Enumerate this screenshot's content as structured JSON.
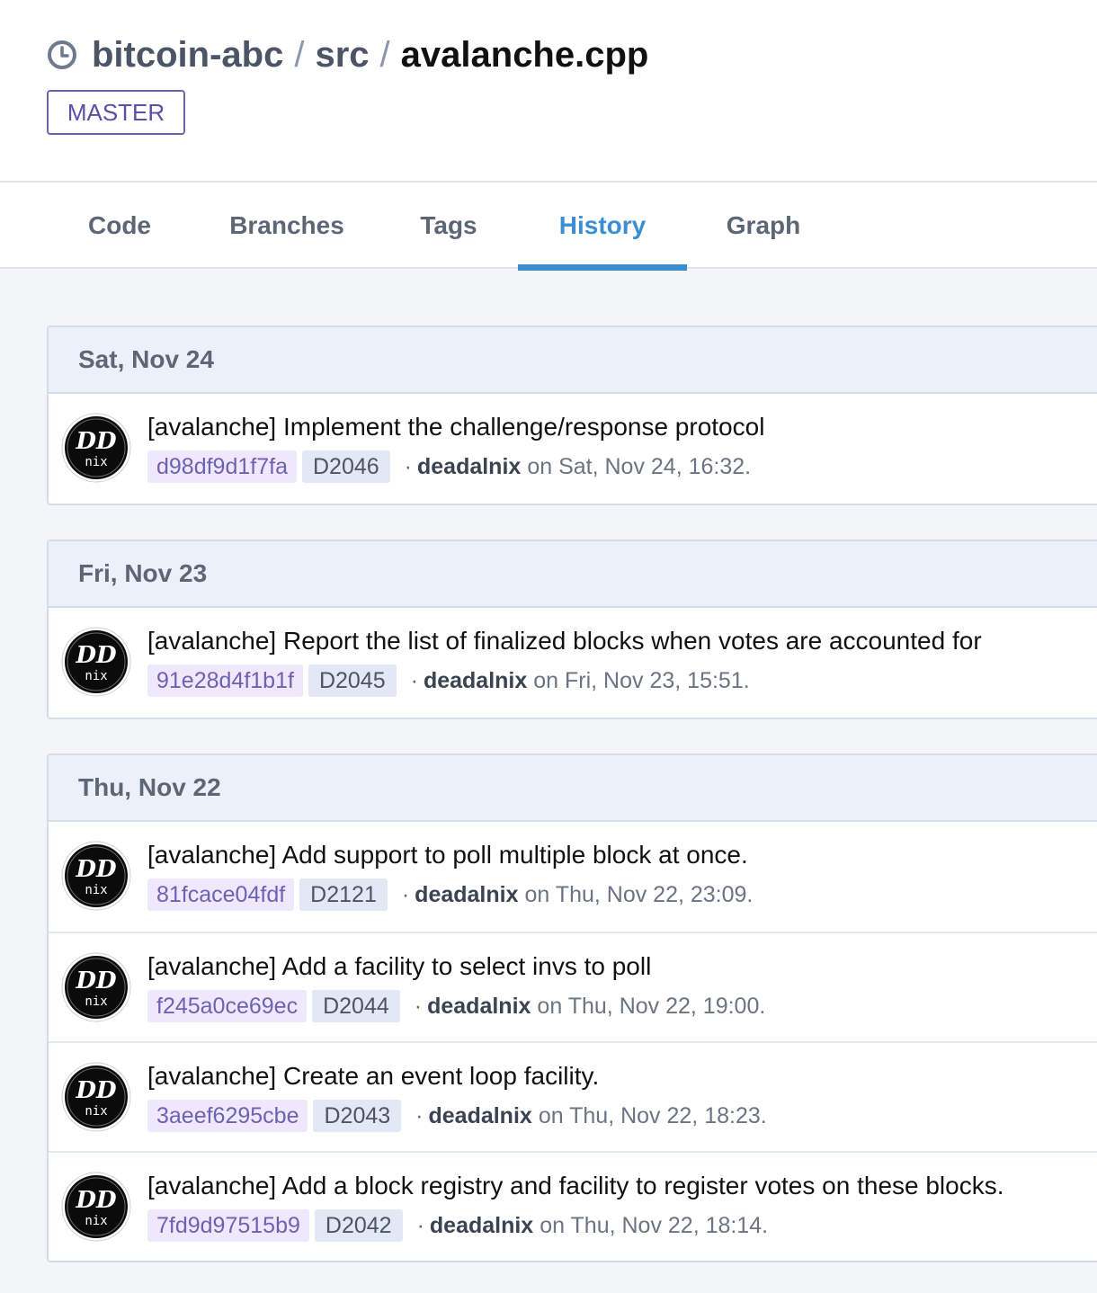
{
  "breadcrumb": {
    "repo": "bitcoin-abc",
    "separator": "/",
    "dir": "src",
    "file": "avalanche.cpp"
  },
  "branch": "MASTER",
  "tabs": [
    {
      "label": "Code",
      "active": false
    },
    {
      "label": "Branches",
      "active": false
    },
    {
      "label": "Tags",
      "active": false
    },
    {
      "label": "History",
      "active": true
    },
    {
      "label": "Graph",
      "active": false
    }
  ],
  "colors": {
    "accent": "#3c8ed3",
    "hash": "#6f61b2",
    "hash_bg": "#ede8fb",
    "rev_bg": "#e2e9f4",
    "group_head_bg": "#ebf0f9"
  },
  "avatar_text": {
    "top": "DD",
    "bottom": "nix"
  },
  "groups": [
    {
      "date": "Sat, Nov 24",
      "commits": [
        {
          "title": "[avalanche] Implement the challenge/response protocol",
          "hash": "d98df9d1f7fa",
          "rev": "D2046",
          "dot": "·",
          "author": "deadalnix",
          "when": "on Sat, Nov 24, 16:32."
        }
      ]
    },
    {
      "date": "Fri, Nov 23",
      "commits": [
        {
          "title": "[avalanche] Report the list of finalized blocks when votes are accounted for",
          "hash": "91e28d4f1b1f",
          "rev": "D2045",
          "dot": "·",
          "author": "deadalnix",
          "when": "on Fri, Nov 23, 15:51."
        }
      ]
    },
    {
      "date": "Thu, Nov 22",
      "commits": [
        {
          "title": "[avalanche] Add support to poll multiple block at once.",
          "hash": "81fcace04fdf",
          "rev": "D2121",
          "dot": "·",
          "author": "deadalnix",
          "when": "on Thu, Nov 22, 23:09."
        },
        {
          "title": "[avalanche] Add a facility to select invs to poll",
          "hash": "f245a0ce69ec",
          "rev": "D2044",
          "dot": "·",
          "author": "deadalnix",
          "when": "on Thu, Nov 22, 19:00."
        },
        {
          "title": "[avalanche] Create an event loop facility.",
          "hash": "3aeef6295cbe",
          "rev": "D2043",
          "dot": "·",
          "author": "deadalnix",
          "when": "on Thu, Nov 22, 18:23."
        },
        {
          "title": "[avalanche] Add a block registry and facility to register votes on these blocks.",
          "hash": "7fd9d97515b9",
          "rev": "D2042",
          "dot": "·",
          "author": "deadalnix",
          "when": "on Thu, Nov 22, 18:14."
        }
      ]
    }
  ]
}
